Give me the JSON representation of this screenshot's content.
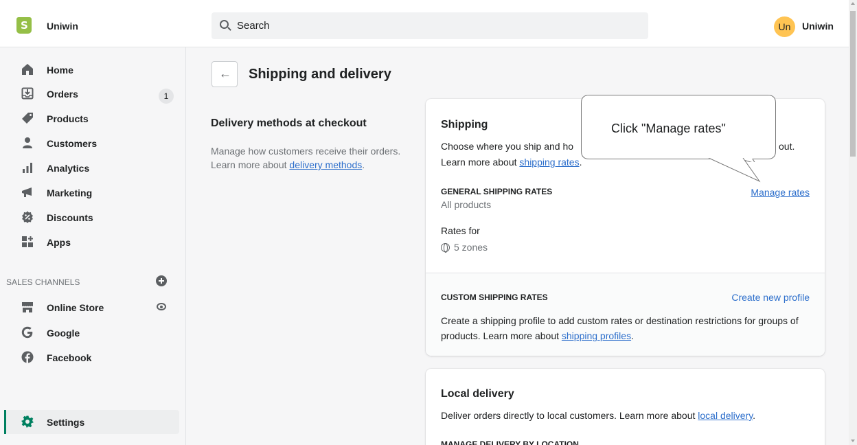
{
  "topbar": {
    "store_name": "Uniwin",
    "search_placeholder": "Search",
    "avatar_initials": "Un",
    "user_name": "Uniwin",
    "logo_color": "#95bf47"
  },
  "sidebar": {
    "items": [
      {
        "label": "Home",
        "icon": "home-icon"
      },
      {
        "label": "Orders",
        "icon": "orders-icon",
        "badge": "1"
      },
      {
        "label": "Products",
        "icon": "tag-icon"
      },
      {
        "label": "Customers",
        "icon": "person-icon"
      },
      {
        "label": "Analytics",
        "icon": "bar-chart-icon"
      },
      {
        "label": "Marketing",
        "icon": "megaphone-icon"
      },
      {
        "label": "Discounts",
        "icon": "discount-icon"
      },
      {
        "label": "Apps",
        "icon": "apps-icon"
      }
    ],
    "sales_channels_title": "SALES CHANNELS",
    "channels": [
      {
        "label": "Online Store",
        "icon": "store-icon"
      },
      {
        "label": "Google",
        "icon": "google-icon"
      },
      {
        "label": "Facebook",
        "icon": "facebook-icon"
      }
    ],
    "settings_label": "Settings",
    "active_color": "#008060"
  },
  "page": {
    "title": "Shipping and delivery",
    "back_icon": "←"
  },
  "delivery_methods": {
    "heading": "Delivery methods at checkout",
    "desc_prefix": "Manage how customers receive their orders. Learn more about ",
    "desc_link": "delivery methods",
    "desc_suffix": "."
  },
  "shipping_card": {
    "title": "Shipping",
    "desc_line1": "Choose where you ship and ho",
    "desc_line1_end": "out.",
    "desc_line2_prefix": "Learn more about ",
    "desc_line2_link": "shipping rates",
    "desc_line2_suffix": ".",
    "general_heading": "GENERAL SHIPPING RATES",
    "general_sub": "All products",
    "manage_rates": "Manage rates",
    "rates_for": "Rates for",
    "zones": "5 zones",
    "custom_heading": "CUSTOM SHIPPING RATES",
    "create_profile": "Create new profile",
    "custom_desc_prefix": "Create a shipping profile to add custom rates or destination restrictions for groups of products. Learn more about ",
    "custom_desc_link": "shipping profiles",
    "custom_desc_suffix": "."
  },
  "local_delivery_card": {
    "title": "Local delivery",
    "desc_prefix": "Deliver orders directly to local customers. Learn more about ",
    "desc_link": "local delivery",
    "desc_suffix": ".",
    "manage_heading": "MANAGE DELIVERY BY LOCATION"
  },
  "callout": {
    "text": "Click \"Manage rates\""
  }
}
